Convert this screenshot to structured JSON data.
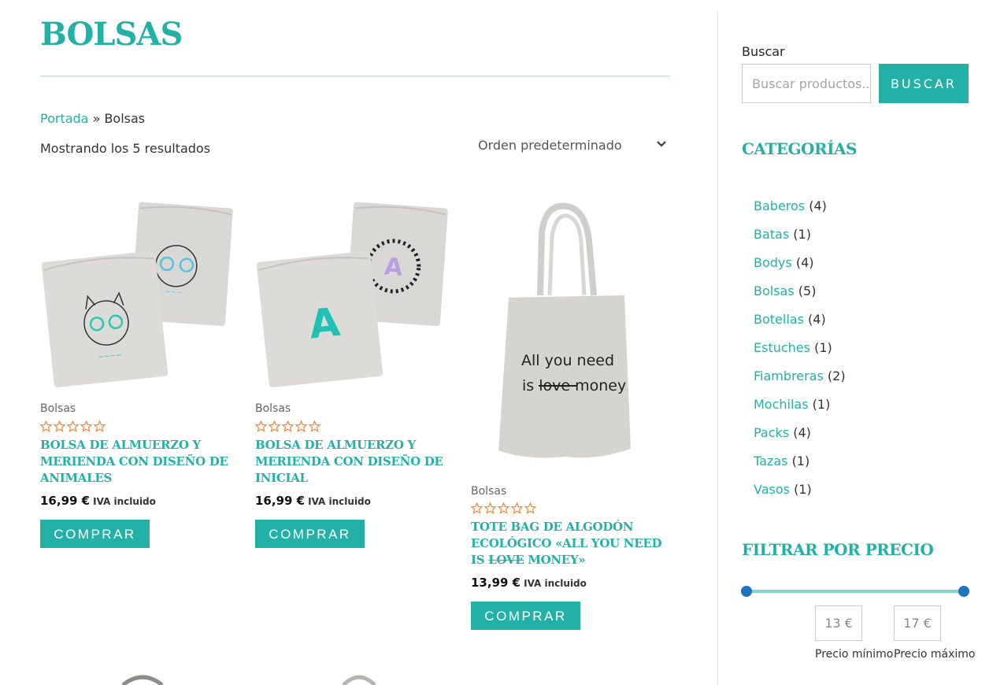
{
  "page": {
    "title": "BOLSAS"
  },
  "breadcrumb": {
    "home": "Portada",
    "separator": " » ",
    "current": "Bolsas"
  },
  "shop": {
    "result_count": "Mostrando los 5 resultados",
    "orderby": "Orden predeterminado"
  },
  "products": [
    {
      "category": "Bolsas",
      "name": "BOLSA DE ALMUERZO Y MERIENDA CON DISEÑO DE ANIMALES",
      "price": "16,99 €",
      "tax": "IVA incluido",
      "button": "COMPRAR",
      "rating": 0
    },
    {
      "category": "Bolsas",
      "name": "BOLSA DE ALMUERZO Y MERIENDA CON DISEÑO DE INICIAL",
      "price": "16,99 €",
      "tax": "IVA incluido",
      "button": "COMPRAR",
      "rating": 0
    },
    {
      "category": "Bolsas",
      "name_prefix": "TOTE BAG DE ALGODÓN ECOLÓGICO «ALL YOU NEED IS ",
      "name_strike": "LOVE",
      "name_suffix": " MONEY»",
      "price": "13,99 €",
      "tax": "IVA incluido",
      "button": "COMPRAR",
      "rating": 0,
      "image_text_1": "All you need",
      "image_text_2": "is",
      "image_text_strike": "love",
      "image_text_3": "money"
    }
  ],
  "sidebar": {
    "search": {
      "label": "Buscar",
      "placeholder": "Buscar productos...",
      "button": "BUSCAR"
    },
    "categories": {
      "title": "CATEGORÍAS",
      "items": [
        {
          "label": "Baberos",
          "count": "(4)"
        },
        {
          "label": "Batas",
          "count": "(1)"
        },
        {
          "label": "Bodys",
          "count": "(4)"
        },
        {
          "label": "Bolsas",
          "count": "(5)"
        },
        {
          "label": "Botellas",
          "count": "(4)"
        },
        {
          "label": "Estuches",
          "count": "(1)"
        },
        {
          "label": "Fiambreras",
          "count": "(2)"
        },
        {
          "label": "Mochilas",
          "count": "(1)"
        },
        {
          "label": "Packs",
          "count": "(4)"
        },
        {
          "label": "Tazas",
          "count": "(1)"
        },
        {
          "label": "Vasos",
          "count": "(1)"
        }
      ]
    },
    "price_filter": {
      "title": "FILTRAR POR PRECIO",
      "min": "13 €",
      "max": "17 €",
      "min_label": "Precio mínimo",
      "max_label": "Precio máximo"
    }
  },
  "colors": {
    "accent": "#23b0a6",
    "slider_handle": "#1e73be",
    "star": "#f0883a"
  }
}
